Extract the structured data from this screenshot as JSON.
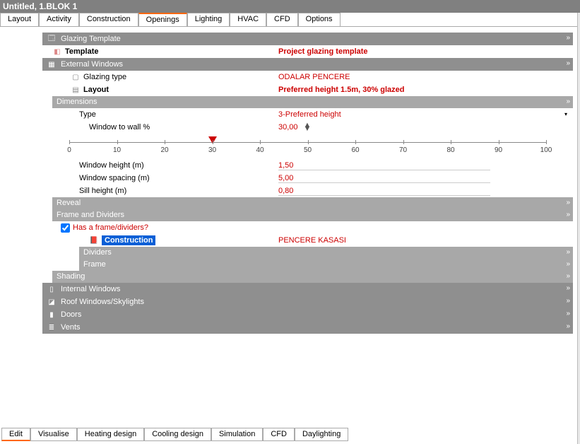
{
  "title": "Untitled, 1.BLOK 1",
  "topTabs": [
    "Layout",
    "Activity",
    "Construction",
    "Openings",
    "Lighting",
    "HVAC",
    "CFD",
    "Options"
  ],
  "activeTopTab": "Openings",
  "sections": {
    "glazingTemplate": {
      "header": "Glazing Template",
      "templateLabel": "Template",
      "templateValue": "Project glazing template"
    },
    "externalWindows": {
      "header": "External Windows",
      "glazingTypeLabel": "Glazing type",
      "glazingTypeValue": "ODALAR PENCERE",
      "layoutLabel": "Layout",
      "layoutValue": "Preferred height 1.5m, 30% glazed",
      "dimensions": {
        "header": "Dimensions",
        "typeLabel": "Type",
        "typeValue": "3-Preferred height",
        "wtwLabel": "Window to wall %",
        "wtwValue": "30,00",
        "sliderTicks": [
          "0",
          "10",
          "20",
          "30",
          "40",
          "50",
          "60",
          "70",
          "80",
          "90",
          "100"
        ],
        "sliderPos": 30,
        "heightLabel": "Window height (m)",
        "heightValue": "1,50",
        "spacingLabel": "Window spacing (m)",
        "spacingValue": "5,00",
        "sillLabel": "Sill height (m)",
        "sillValue": "0,80"
      },
      "reveal": "Reveal",
      "frameDividers": {
        "header": "Frame and Dividers",
        "hasFrameLabel": "Has a frame/dividers?",
        "hasFrame": true,
        "constructionLabel": "Construction",
        "constructionValue": "PENCERE KASASI",
        "dividers": "Dividers",
        "frame": "Frame"
      },
      "shading": "Shading"
    },
    "internalWindows": "Internal Windows",
    "roofWindows": "Roof Windows/Skylights",
    "doors": "Doors",
    "vents": "Vents"
  },
  "bottomTabs": [
    "Edit",
    "Visualise",
    "Heating design",
    "Cooling design",
    "Simulation",
    "CFD",
    "Daylighting"
  ],
  "activeBottomTab": "Edit"
}
